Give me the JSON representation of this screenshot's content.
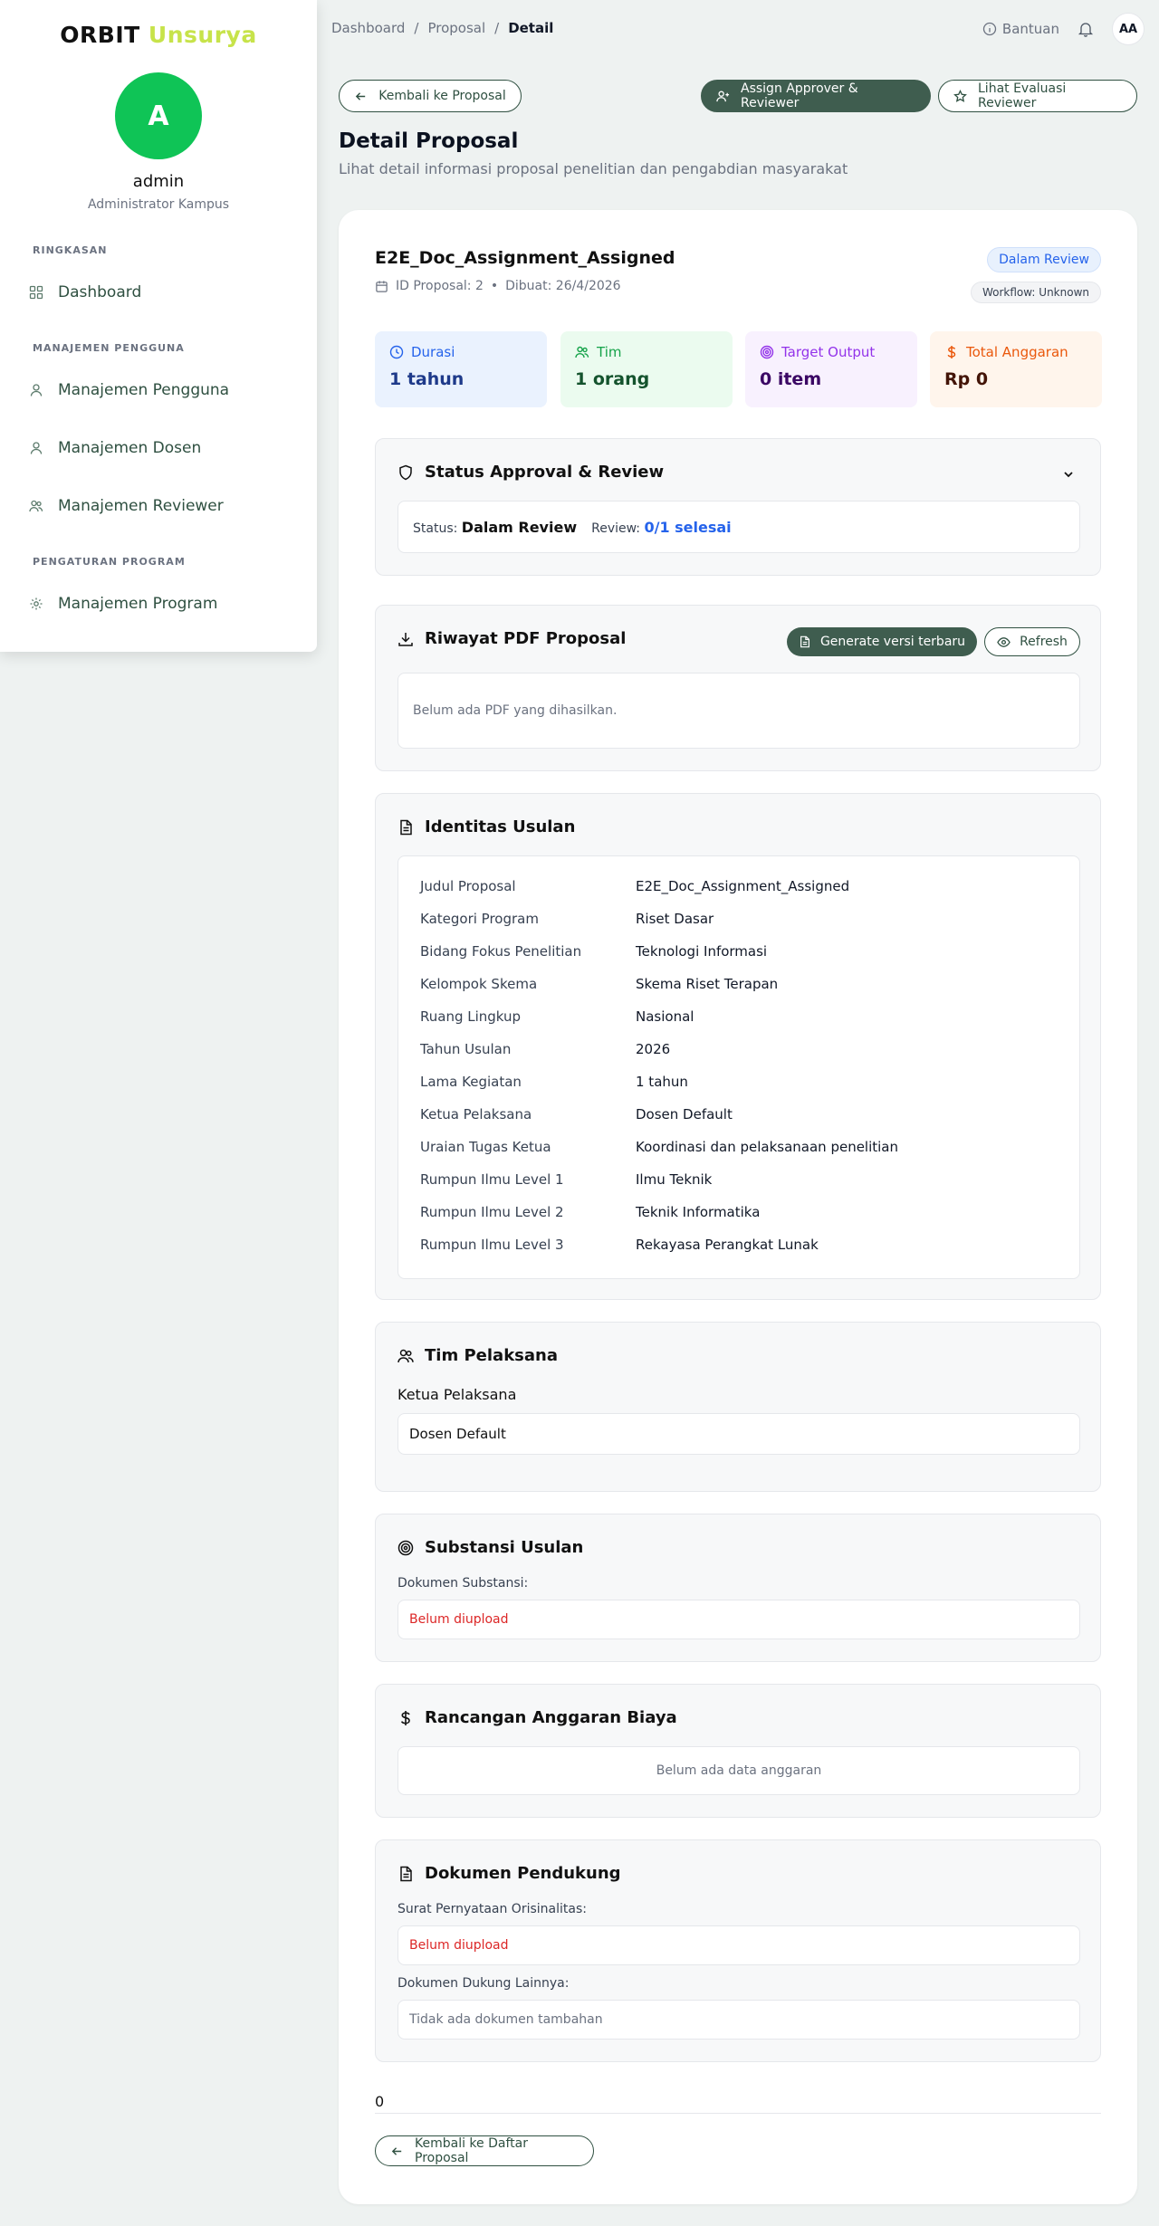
{
  "brand": {
    "part1": "ORBIT",
    "part2": "Unsurya"
  },
  "user": {
    "initial": "A",
    "name": "admin",
    "role": "Administrator Kampus"
  },
  "nav": {
    "sections": [
      {
        "label": "RINGKASAN",
        "items": [
          {
            "label": "Dashboard",
            "icon": "grid-icon"
          }
        ]
      },
      {
        "label": "MANAJEMEN PENGGUNA",
        "items": [
          {
            "label": "Manajemen Pengguna",
            "icon": "user-icon"
          },
          {
            "label": "Manajemen Dosen",
            "icon": "user-icon"
          },
          {
            "label": "Manajemen Reviewer",
            "icon": "users-icon"
          }
        ]
      },
      {
        "label": "PENGATURAN PROGRAM",
        "items": [
          {
            "label": "Manajemen Program",
            "icon": "gear-icon"
          }
        ]
      }
    ]
  },
  "breadcrumb": {
    "items": [
      "Dashboard",
      "Proposal"
    ],
    "current": "Detail",
    "separator": "/"
  },
  "topbar": {
    "help": "Bantuan",
    "avatar": "AA"
  },
  "header": {
    "back": "Kembali ke Proposal",
    "assign": "Assign Approver & Reviewer",
    "evaluate": "Lihat Evaluasi Reviewer",
    "title": "Detail Proposal",
    "subtitle": "Lihat detail informasi proposal penelitian dan pengabdian masyarakat"
  },
  "proposal": {
    "title": "E2E_Doc_Assignment_Assigned",
    "id_label": "ID Proposal: 2",
    "dot": "•",
    "created": "Dibuat: 26/4/2026",
    "status_badge": "Dalam Review",
    "workflow_badge": "Workflow: Unknown"
  },
  "stats": [
    {
      "label": "Durasi",
      "value": "1 tahun",
      "color": "#2563eb",
      "bg": "#eaf2fe",
      "valcolor": "#1e3a8a"
    },
    {
      "label": "Tim",
      "value": "1 orang",
      "color": "#16a34a",
      "bg": "#ebfbef",
      "valcolor": "#14532d"
    },
    {
      "label": "Target Output",
      "value": "0 item",
      "color": "#9333ea",
      "bg": "#f8f1fe",
      "valcolor": "#3b0764"
    },
    {
      "label": "Total Anggaran",
      "value": "Rp 0",
      "color": "#ea580c",
      "bg": "#fff5ec",
      "valcolor": "#431407"
    }
  ],
  "approval": {
    "title": "Status Approval & Review",
    "status_label": "Status:",
    "status_value": "Dalam Review",
    "review_label": "Review:",
    "review_value": "0/1 selesai"
  },
  "pdf": {
    "title": "Riwayat PDF Proposal",
    "generate": "Generate versi terbaru",
    "refresh": "Refresh",
    "empty": "Belum ada PDF yang dihasilkan."
  },
  "identity": {
    "title": "Identitas Usulan",
    "rows": [
      {
        "k": "Judul Proposal",
        "v": "E2E_Doc_Assignment_Assigned"
      },
      {
        "k": "Kategori Program",
        "v": "Riset Dasar"
      },
      {
        "k": "Bidang Fokus Penelitian",
        "v": "Teknologi Informasi"
      },
      {
        "k": "Kelompok Skema",
        "v": "Skema Riset Terapan"
      },
      {
        "k": "Ruang Lingkup",
        "v": "Nasional"
      },
      {
        "k": "Tahun Usulan",
        "v": "2026"
      },
      {
        "k": "Lama Kegiatan",
        "v": "1 tahun"
      },
      {
        "k": "Ketua Pelaksana",
        "v": "Dosen Default"
      },
      {
        "k": "Uraian Tugas Ketua",
        "v": "Koordinasi dan pelaksanaan penelitian"
      },
      {
        "k": "Rumpun Ilmu Level 1",
        "v": "Ilmu Teknik"
      },
      {
        "k": "Rumpun Ilmu Level 2",
        "v": "Teknik Informatika"
      },
      {
        "k": "Rumpun Ilmu Level 3",
        "v": "Rekayasa Perangkat Lunak"
      }
    ]
  },
  "team": {
    "title": "Tim Pelaksana",
    "leader_label": "Ketua Pelaksana",
    "leader": "Dosen Default"
  },
  "substance": {
    "title": "Substansi Usulan",
    "doc_label": "Dokumen Substansi:",
    "doc_value": "Belum diupload"
  },
  "budget": {
    "title": "Rancangan Anggaran Biaya",
    "empty": "Belum ada data anggaran"
  },
  "support": {
    "title": "Dokumen Pendukung",
    "orig_label": "Surat Pernyataan Orisinalitas:",
    "orig_value": "Belum diupload",
    "other_label": "Dokumen Dukung Lainnya:",
    "other_value": "Tidak ada dokumen tambahan"
  },
  "footer": {
    "count": "0",
    "back": "Kembali ke Daftar Proposal"
  }
}
